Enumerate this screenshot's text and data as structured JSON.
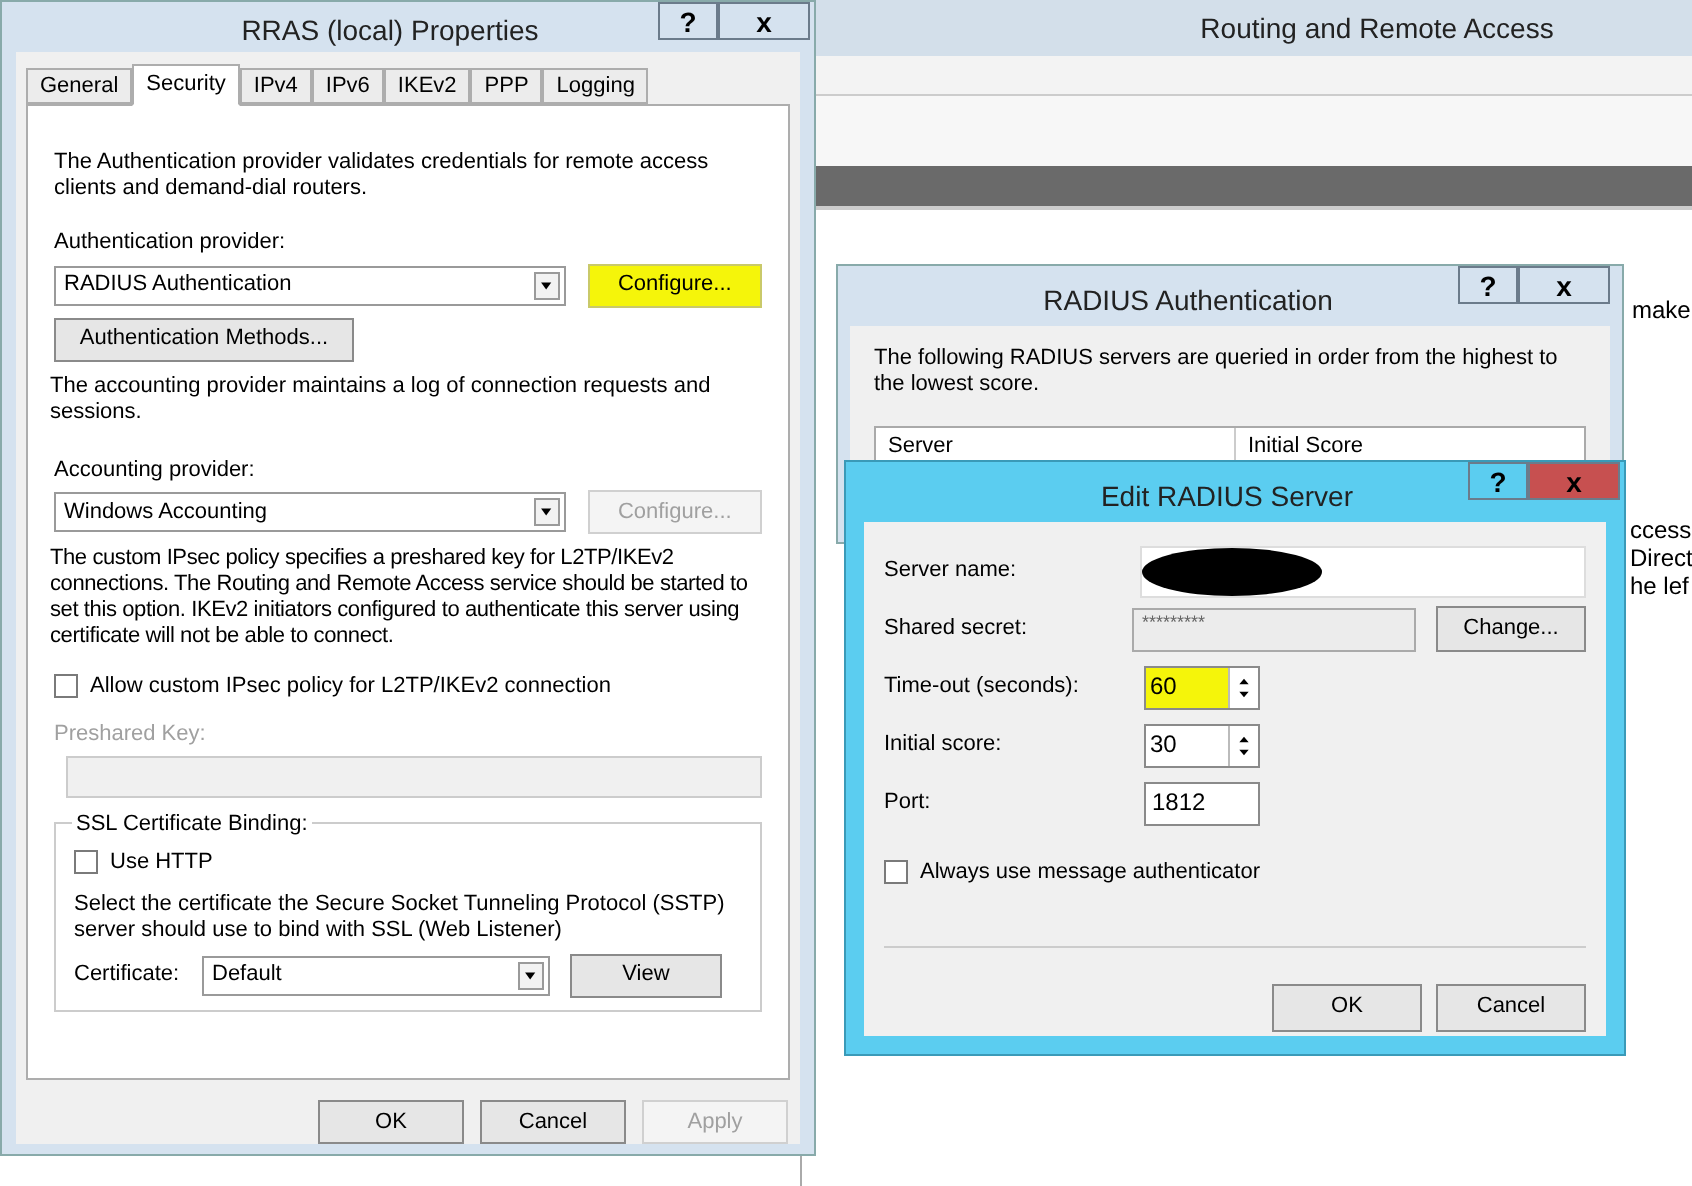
{
  "background_window": {
    "title": "Routing and Remote Access",
    "text_fragments": [
      "make",
      "ccess",
      "Direct",
      "he lef"
    ]
  },
  "properties_dialog": {
    "title": "RRAS (local) Properties",
    "help": "?",
    "close": "x",
    "tabs": [
      {
        "label": "General",
        "selected": false
      },
      {
        "label": "Security",
        "selected": true
      },
      {
        "label": "IPv4",
        "selected": false
      },
      {
        "label": "IPv6",
        "selected": false
      },
      {
        "label": "IKEv2",
        "selected": false
      },
      {
        "label": "PPP",
        "selected": false
      },
      {
        "label": "Logging",
        "selected": false
      }
    ],
    "auth_description": "The Authentication provider validates credentials for remote access clients and demand-dial routers.",
    "auth_provider_label": "Authentication provider:",
    "auth_provider": "RADIUS Authentication",
    "auth_configure": {
      "label": "Configure...",
      "disabled": false,
      "highlighted": true
    },
    "auth_methods_button": "Authentication Methods...",
    "accounting_description": "The accounting provider maintains a log of connection requests and sessions.",
    "accounting_provider_label": "Accounting provider:",
    "accounting_provider": "Windows Accounting",
    "accounting_configure": {
      "label": "Configure...",
      "disabled": true,
      "highlighted": false
    },
    "ipsec_description": "The custom IPsec policy specifies a preshared key for L2TP/IKEv2 connections. The Routing and Remote Access service should be started to set this option. IKEv2 initiators configured to authenticate this server using certificate will not be able to connect.",
    "custom_ipsec": {
      "label": "Allow custom IPsec policy for L2TP/IKEv2 connection",
      "checked": false
    },
    "preshared_key": {
      "label": "Preshared Key:",
      "disabled": true
    },
    "ssl_group": {
      "title": "SSL Certificate Binding:",
      "use_http": {
        "label": "Use HTTP",
        "checked": false
      },
      "description": "Select the certificate the Secure Socket Tunneling Protocol (SSTP) server should use to bind with SSL (Web Listener)",
      "certificate_label": "Certificate:",
      "certificate": "Default",
      "view_button": "View"
    },
    "buttons": [
      {
        "label": "OK",
        "disabled": false
      },
      {
        "label": "Cancel",
        "disabled": false
      },
      {
        "label": "Apply",
        "disabled": true
      }
    ]
  },
  "radius_dialog": {
    "title": "RADIUS Authentication",
    "help": "?",
    "close": "x",
    "description": "The following RADIUS servers are queried in order from the highest to the lowest score.",
    "columns": [
      "Server",
      "Initial Score"
    ]
  },
  "edit_dialog": {
    "title": "Edit RADIUS Server",
    "help": "?",
    "close": "x",
    "fields": [
      {
        "kind": "redacted",
        "label": "Server name:"
      },
      {
        "kind": "secret",
        "label": "Shared secret:",
        "value": "*********",
        "button": "Change..."
      },
      {
        "kind": "spin",
        "label": "Time-out (seconds):",
        "value": "60",
        "highlighted": true
      },
      {
        "kind": "spin",
        "label": "Initial score:",
        "value": "30",
        "highlighted": false
      },
      {
        "kind": "text",
        "label": "Port:",
        "value": "1812"
      }
    ],
    "message_authenticator": {
      "label": "Always use message authenticator",
      "checked": false
    },
    "buttons": [
      "OK",
      "Cancel"
    ]
  }
}
